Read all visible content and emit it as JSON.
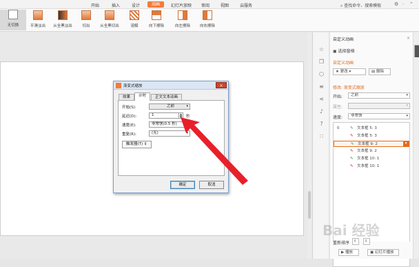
{
  "menubar": {
    "tabs": [
      "开始",
      "插入",
      "设计",
      "动画",
      "幻灯片放映",
      "审阅",
      "视图",
      "云服务"
    ],
    "active_tab": "动画",
    "search_placeholder": "查找命令、搜索模板"
  },
  "ribbon": {
    "items": [
      "无切换",
      "平滑淡出",
      "从全黑淡出",
      "切出",
      "从全黑切出",
      "溶解",
      "向下擦除",
      "向左擦除",
      "向右擦除"
    ]
  },
  "panel": {
    "title": "自定义动画",
    "select_pane": "选择窗格",
    "custom_animation_label": "自定义动画",
    "change_button": "更改",
    "delete_button": "删除",
    "modify_label": "修改: 渐变式缩放",
    "start_label": "开始:",
    "start_value": "之前",
    "property_label": "属性:",
    "speed_label": "速度:",
    "speed_value": "非常快",
    "list_items": [
      {
        "num": "0",
        "text": "文本框 5: 3"
      },
      {
        "num": "",
        "text": "文本框 5: 3"
      },
      {
        "num": "",
        "text": "文本框 9: 2"
      },
      {
        "num": "",
        "text": "文本框 9: 2"
      },
      {
        "num": "",
        "text": "文本框 10: 1"
      },
      {
        "num": "",
        "text": "文本框 10: 1"
      }
    ],
    "reorder_label": "重新排序",
    "play_button": "播放",
    "slideshow_button": "幻灯片播放"
  },
  "dialog": {
    "title": "渐变式缩放",
    "tabs": [
      "效果",
      "计时",
      "正文文本动画"
    ],
    "active_tab": "计时",
    "start_label": "开始(S):",
    "start_value": "之前",
    "delay_label": "延迟(D):",
    "delay_value": "1",
    "delay_unit": "秒",
    "speed_label": "速度(E):",
    "speed_value": "非常快(0.5 秒)",
    "repeat_label": "重复(R):",
    "repeat_value": "(无)",
    "trigger_button": "触发器(T)",
    "ok_button": "确定",
    "cancel_button": "取消"
  },
  "watermark": "Bai 经验",
  "colors": {
    "accent": "#f27c3a",
    "arrow": "#e8202a"
  }
}
